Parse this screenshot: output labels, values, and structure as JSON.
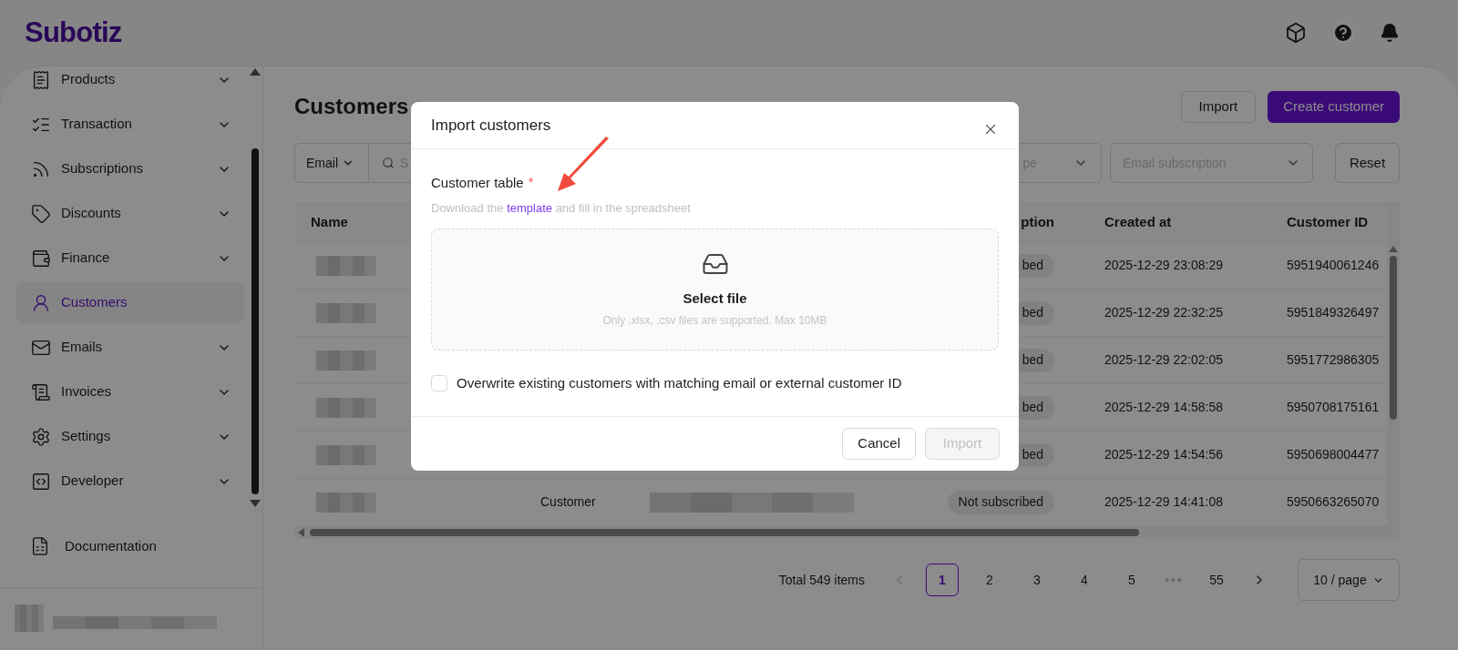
{
  "header": {
    "logo": "Subotiz"
  },
  "sidebar": {
    "items": [
      {
        "label": "Products",
        "expandable": true,
        "selected": false
      },
      {
        "label": "Transaction",
        "expandable": true,
        "selected": false
      },
      {
        "label": "Subscriptions",
        "expandable": true,
        "selected": false
      },
      {
        "label": "Discounts",
        "expandable": true,
        "selected": false
      },
      {
        "label": "Finance",
        "expandable": true,
        "selected": false
      },
      {
        "label": "Customers",
        "expandable": false,
        "selected": true
      },
      {
        "label": "Emails",
        "expandable": true,
        "selected": false
      },
      {
        "label": "Invoices",
        "expandable": true,
        "selected": false
      },
      {
        "label": "Settings",
        "expandable": true,
        "selected": false
      },
      {
        "label": "Developer",
        "expandable": true,
        "selected": false
      }
    ],
    "documentation": "Documentation"
  },
  "page": {
    "title": "Customers",
    "import_button": "Import",
    "create_button": "Create customer"
  },
  "filters": {
    "field_select": "Email",
    "search_placeholder": "S",
    "type_select": "pe",
    "subscription_placeholder": "Email subscription",
    "reset": "Reset"
  },
  "table": {
    "columns": [
      "Name",
      "ption",
      "Created at",
      "Customer ID"
    ],
    "rows": [
      {
        "subscription": "bed",
        "created_at": "2025-12-29 23:08:29",
        "customer_id": "5951940061246"
      },
      {
        "subscription": "bed",
        "created_at": "2025-12-29 22:32:25",
        "customer_id": "5951849326497"
      },
      {
        "subscription": "bed",
        "created_at": "2025-12-29 22:02:05",
        "customer_id": "5951772986305"
      },
      {
        "subscription": "bed",
        "created_at": "2025-12-29 14:58:58",
        "customer_id": "5950708175161"
      },
      {
        "subscription": "bed",
        "created_at": "2025-12-29 14:54:56",
        "customer_id": "5950698004477"
      },
      {
        "type": "Customer",
        "subscription": "Not subscribed",
        "created_at": "2025-12-29 14:41:08",
        "customer_id": "5950663265070"
      }
    ]
  },
  "pagination": {
    "total": "Total 549 items",
    "prev_disabled": true,
    "next_disabled": false,
    "pages": [
      {
        "label": "1",
        "kind": "page",
        "selected": true
      },
      {
        "label": "2",
        "kind": "page",
        "selected": false
      },
      {
        "label": "3",
        "kind": "page",
        "selected": false
      },
      {
        "label": "4",
        "kind": "page",
        "selected": false
      },
      {
        "label": "5",
        "kind": "page",
        "selected": false
      },
      {
        "label": "•••",
        "kind": "ellipsis",
        "selected": false
      },
      {
        "label": "55",
        "kind": "page",
        "selected": false
      }
    ],
    "page_size": "10 / page"
  },
  "modal": {
    "title": "Import customers",
    "field_label": "Customer table",
    "required_mark": "*",
    "hint_before": "Download the",
    "hint_link": "template",
    "hint_after": "and fill in the spreadsheet",
    "dropzone_title": "Select file",
    "dropzone_hint": "Only .xlsx, .csv files are supported. Max 10MB",
    "overwrite_label": "Overwrite existing customers with matching email or external customer ID",
    "overwrite_checked": false,
    "cancel": "Cancel",
    "import": "Import",
    "import_disabled": true
  }
}
